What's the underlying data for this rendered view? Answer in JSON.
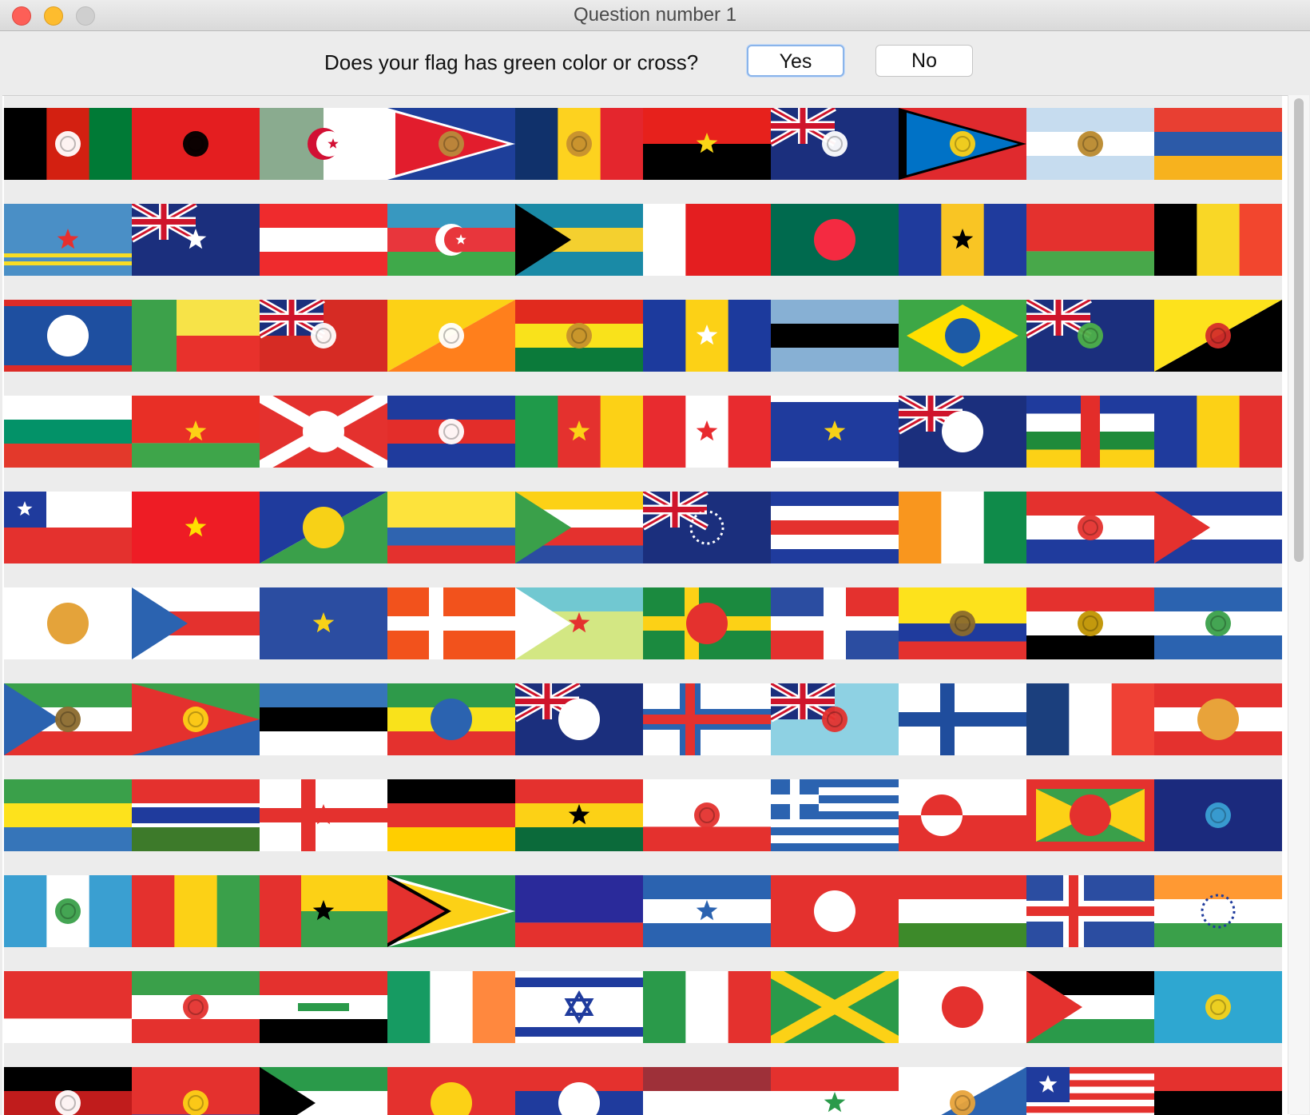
{
  "window": {
    "title": "Question number 1"
  },
  "question": {
    "text": "Does your flag has green color or cross?",
    "yes_label": "Yes",
    "no_label": "No"
  },
  "flags": [
    {
      "name": "afghanistan",
      "layout": "v",
      "colors": [
        "#000000",
        "#d32011",
        "#007a36"
      ],
      "emblem": "circle",
      "emblemColor": "#ffffff"
    },
    {
      "name": "albania",
      "layout": "solid",
      "colors": [
        "#e41e20"
      ],
      "emblem": "circle",
      "emblemColor": "#000000"
    },
    {
      "name": "algeria",
      "layout": "v",
      "colors": [
        "#8aab8f",
        "#ffffff"
      ],
      "emblem": "crescent",
      "emblemColor": "#d21034"
    },
    {
      "name": "american-samoa",
      "layout": "triangle",
      "colors": [
        "#1e3f9a",
        "#ffffff",
        "#e21d2d"
      ],
      "emblem": "circle",
      "emblemColor": "#b88a3b"
    },
    {
      "name": "andorra",
      "layout": "v",
      "colors": [
        "#10316b",
        "#fdd21f",
        "#e4262d"
      ],
      "emblem": "circle",
      "emblemColor": "#c7902f"
    },
    {
      "name": "angola",
      "layout": "h",
      "colors": [
        "#e7211c",
        "#000000"
      ],
      "emblem": "star",
      "emblemColor": "#f9d616"
    },
    {
      "name": "anguilla",
      "layout": "ensign",
      "colors": [
        "#1b2f7d",
        "#ffffff",
        "#cf142b"
      ],
      "emblem": "circle",
      "emblemColor": "#ffffff"
    },
    {
      "name": "antigua-and-barbuda",
      "layout": "triangle",
      "colors": [
        "#e02a2e",
        "#000000",
        "#0072c6",
        "#ffffff"
      ],
      "emblem": "circle",
      "emblemColor": "#fcd116"
    },
    {
      "name": "argentina",
      "layout": "h",
      "colors": [
        "#c6dcef",
        "#ffffff",
        "#c6dcef"
      ],
      "emblem": "circle",
      "emblemColor": "#b9892d"
    },
    {
      "name": "armenia",
      "layout": "h",
      "colors": [
        "#e83f32",
        "#2c5aa8",
        "#f7b21e"
      ]
    },
    {
      "name": "aruba",
      "layout": "stripes",
      "colors": [
        "#4a8fc6",
        "#f8dd26"
      ],
      "emblem": "star",
      "emblemColor": "#e72f2e"
    },
    {
      "name": "australia",
      "layout": "ensign",
      "colors": [
        "#1b2f7d",
        "#ffffff",
        "#cf142b"
      ],
      "emblem": "star",
      "emblemColor": "#ffffff"
    },
    {
      "name": "austria",
      "layout": "h",
      "colors": [
        "#ef2b2d",
        "#ffffff",
        "#ef2b2d"
      ]
    },
    {
      "name": "azerbaijan",
      "layout": "h",
      "colors": [
        "#3898c0",
        "#e8363c",
        "#3fa94a"
      ],
      "emblem": "crescent",
      "emblemColor": "#ffffff"
    },
    {
      "name": "bahamas",
      "layout": "htri",
      "colors": [
        "#1a8aa6",
        "#f4d02f",
        "#1a8aa6",
        "#000000"
      ]
    },
    {
      "name": "bahrain",
      "layout": "v",
      "colors": [
        "#ffffff",
        "#e41e20",
        "#e41e20"
      ]
    },
    {
      "name": "bangladesh",
      "layout": "solid",
      "colors": [
        "#006a4e"
      ],
      "emblem": "disc",
      "emblemColor": "#f42a41"
    },
    {
      "name": "barbados",
      "layout": "v",
      "colors": [
        "#1f3b9d",
        "#f9c524",
        "#1f3b9d"
      ],
      "emblem": "star",
      "emblemColor": "#000000"
    },
    {
      "name": "belarus",
      "layout": "h2",
      "colors": [
        "#e4312e",
        "#48a84a"
      ]
    },
    {
      "name": "belgium",
      "layout": "v",
      "colors": [
        "#000000",
        "#f9d726",
        "#f2462e"
      ]
    },
    {
      "name": "belize",
      "layout": "hbar",
      "colors": [
        "#1e4fa0",
        "#dc2b27"
      ],
      "emblem": "disc",
      "emblemColor": "#ffffff"
    },
    {
      "name": "benin",
      "layout": "benin",
      "colors": [
        "#3ca14a",
        "#f7e348",
        "#e8312c"
      ]
    },
    {
      "name": "bermuda",
      "layout": "ensign",
      "colors": [
        "#d62b24",
        "#ffffff",
        "#1b2f7d"
      ],
      "emblem": "circle",
      "emblemColor": "#ffffff"
    },
    {
      "name": "bhutan",
      "layout": "diag",
      "colors": [
        "#fcd116",
        "#ff7f1c"
      ],
      "emblem": "circle",
      "emblemColor": "#ffffff"
    },
    {
      "name": "bolivia",
      "layout": "h",
      "colors": [
        "#e12a1e",
        "#f9e21b",
        "#0b7a3a"
      ],
      "emblem": "circle",
      "emblemColor": "#c6912c"
    },
    {
      "name": "bosnia",
      "layout": "v",
      "colors": [
        "#1c3a9d",
        "#fcd116",
        "#1c3a9d"
      ],
      "emblem": "star",
      "emblemColor": "#ffffff"
    },
    {
      "name": "botswana",
      "layout": "h",
      "colors": [
        "#87b0d4",
        "#000000",
        "#87b0d4"
      ]
    },
    {
      "name": "brazil",
      "layout": "brazil",
      "colors": [
        "#3da746",
        "#fedf00",
        "#1d5aa6"
      ]
    },
    {
      "name": "british-virgin-islands",
      "layout": "ensign",
      "colors": [
        "#1b2f7d",
        "#ffffff",
        "#cf142b"
      ],
      "emblem": "circle",
      "emblemColor": "#4db04a"
    },
    {
      "name": "brunei",
      "layout": "diag",
      "colors": [
        "#fde21c",
        "#000000"
      ],
      "emblem": "circle",
      "emblemColor": "#d52d2a"
    },
    {
      "name": "bulgaria",
      "layout": "h",
      "colors": [
        "#ffffff",
        "#039268",
        "#e3392b"
      ]
    },
    {
      "name": "burkina-faso",
      "layout": "h2",
      "colors": [
        "#e82f26",
        "#3ea54a"
      ],
      "emblem": "star",
      "emblemColor": "#fcd116"
    },
    {
      "name": "burundi",
      "layout": "saltire",
      "colors": [
        "#e4312e",
        "#3fa349",
        "#ffffff"
      ],
      "emblem": "disc",
      "emblemColor": "#ffffff"
    },
    {
      "name": "cambodia",
      "layout": "h",
      "colors": [
        "#1f3b9d",
        "#e32d2a",
        "#1f3b9d"
      ],
      "emblem": "circle",
      "emblemColor": "#ffffff"
    },
    {
      "name": "cameroon",
      "layout": "v",
      "colors": [
        "#1f9a4a",
        "#e4312e",
        "#fcd116"
      ],
      "emblem": "star",
      "emblemColor": "#fcd116"
    },
    {
      "name": "canada",
      "layout": "v",
      "colors": [
        "#e82b2f",
        "#ffffff",
        "#e82b2f"
      ],
      "emblem": "star",
      "emblemColor": "#e82b2f"
    },
    {
      "name": "cape-verde",
      "layout": "hbar",
      "colors": [
        "#1f3b9d",
        "#ffffff"
      ],
      "emblem": "star",
      "emblemColor": "#f7d117"
    },
    {
      "name": "cayman-islands",
      "layout": "ensign",
      "colors": [
        "#1b2f7d",
        "#ffffff",
        "#cf142b"
      ],
      "emblem": "disc",
      "emblemColor": "#ffffff"
    },
    {
      "name": "central-african-republic",
      "layout": "car",
      "colors": [
        "#1f3b9d",
        "#ffffff",
        "#1f8a3a",
        "#fcd116",
        "#e32d2a"
      ]
    },
    {
      "name": "chad",
      "layout": "v",
      "colors": [
        "#1f3b9d",
        "#fcd116",
        "#e4312e"
      ]
    },
    {
      "name": "chile",
      "layout": "chile",
      "colors": [
        "#1f3b9d",
        "#ffffff",
        "#e4312e"
      ]
    },
    {
      "name": "china",
      "layout": "solid",
      "colors": [
        "#ee1c25"
      ],
      "emblem": "star",
      "emblemColor": "#ffde00"
    },
    {
      "name": "christmas-island",
      "layout": "diagtri",
      "colors": [
        "#1f3b9d",
        "#3aa04a"
      ],
      "emblem": "disc",
      "emblemColor": "#f7d117"
    },
    {
      "name": "colombia",
      "layout": "h",
      "colors": [
        "#fde33c",
        "#fde33c",
        "#2f64b0",
        "#e4312e"
      ]
    },
    {
      "name": "comoros",
      "layout": "htri",
      "colors": [
        "#fcd116",
        "#ffffff",
        "#e4312e",
        "#2b4da1",
        "#3aa04a"
      ]
    },
    {
      "name": "cook-islands",
      "layout": "ensign",
      "colors": [
        "#1b2f7d",
        "#ffffff",
        "#cf142b"
      ],
      "emblem": "ring",
      "emblemColor": "#ffffff"
    },
    {
      "name": "costa-rica",
      "layout": "h",
      "colors": [
        "#1f3b9d",
        "#ffffff",
        "#e4312e",
        "#ffffff",
        "#1f3b9d"
      ]
    },
    {
      "name": "cote-divoire",
      "layout": "v",
      "colors": [
        "#f9961e",
        "#ffffff",
        "#0f8b4a"
      ]
    },
    {
      "name": "croatia",
      "layout": "h",
      "colors": [
        "#e4312e",
        "#ffffff",
        "#1f3b9d"
      ],
      "emblem": "circle",
      "emblemColor": "#e4312e"
    },
    {
      "name": "cuba",
      "layout": "htri",
      "colors": [
        "#1f3b9d",
        "#ffffff",
        "#1f3b9d",
        "#e4312e"
      ]
    },
    {
      "name": "cyprus",
      "layout": "solid",
      "colors": [
        "#ffffff"
      ],
      "emblem": "disc",
      "emblemColor": "#e4a33a"
    },
    {
      "name": "czech-republic",
      "layout": "htri",
      "colors": [
        "#ffffff",
        "#e4312e",
        "#ffffff",
        "#2b63b0"
      ]
    },
    {
      "name": "dr-congo-old",
      "layout": "solid",
      "colors": [
        "#2b4da1"
      ],
      "emblem": "star",
      "emblemColor": "#f7d117"
    },
    {
      "name": "denmark",
      "layout": "cross",
      "colors": [
        "#f2521c",
        "#ffffff"
      ]
    },
    {
      "name": "djibouti",
      "layout": "htri",
      "colors": [
        "#71c8d1",
        "#d3e783",
        "#d3e783",
        "#ffffff"
      ],
      "emblem": "star",
      "emblemColor": "#e4312e"
    },
    {
      "name": "dominica",
      "layout": "cross",
      "colors": [
        "#1b8a3f",
        "#fcd116"
      ],
      "emblem": "disc",
      "emblemColor": "#e4312e"
    },
    {
      "name": "dominican-republic",
      "layout": "quarters",
      "colors": [
        "#2b4da1",
        "#e4312e",
        "#ffffff"
      ]
    },
    {
      "name": "ecuador",
      "layout": "h",
      "colors": [
        "#fde21c",
        "#fde21c",
        "#1f3b9d",
        "#e4312e"
      ],
      "emblem": "circle",
      "emblemColor": "#8b6a2d"
    },
    {
      "name": "egypt",
      "layout": "h",
      "colors": [
        "#e4312e",
        "#ffffff",
        "#000000"
      ],
      "emblem": "circle",
      "emblemColor": "#c09300"
    },
    {
      "name": "el-salvador",
      "layout": "h",
      "colors": [
        "#2b63b0",
        "#ffffff",
        "#2b63b0"
      ],
      "emblem": "circle",
      "emblemColor": "#3aa04a"
    },
    {
      "name": "equatorial-guinea",
      "layout": "htri",
      "colors": [
        "#3aa04a",
        "#ffffff",
        "#e4312e",
        "#2b63b0"
      ],
      "emblem": "circle",
      "emblemColor": "#8b6a2d"
    },
    {
      "name": "eritrea",
      "layout": "eritrea",
      "colors": [
        "#3aa04a",
        "#2b63b0",
        "#e4312e"
      ],
      "emblem": "circle",
      "emblemColor": "#fcd116"
    },
    {
      "name": "estonia",
      "layout": "h",
      "colors": [
        "#3675b9",
        "#000000",
        "#ffffff"
      ]
    },
    {
      "name": "ethiopia",
      "layout": "h",
      "colors": [
        "#2e9a4a",
        "#f9e21b",
        "#e4312e"
      ],
      "emblem": "disc",
      "emblemColor": "#2b63b0"
    },
    {
      "name": "falkland-islands",
      "layout": "ensign",
      "colors": [
        "#1b2f7d",
        "#ffffff",
        "#cf142b"
      ],
      "emblem": "disc",
      "emblemColor": "#ffffff"
    },
    {
      "name": "faroe-islands",
      "layout": "cross2",
      "colors": [
        "#ffffff",
        "#2b63b0",
        "#e4312e"
      ]
    },
    {
      "name": "fiji",
      "layout": "ensign",
      "colors": [
        "#8ed1e3",
        "#ffffff",
        "#cf142b"
      ],
      "emblem": "circle",
      "emblemColor": "#e4312e"
    },
    {
      "name": "finland",
      "layout": "cross",
      "colors": [
        "#ffffff",
        "#1f4d9d"
      ]
    },
    {
      "name": "france",
      "layout": "v",
      "colors": [
        "#1b3f7d",
        "#ffffff",
        "#ef4135"
      ]
    },
    {
      "name": "french-polynesia",
      "layout": "h",
      "colors": [
        "#e4312e",
        "#ffffff",
        "#e4312e"
      ],
      "emblem": "disc",
      "emblemColor": "#e8a33a"
    },
    {
      "name": "gabon",
      "layout": "h",
      "colors": [
        "#3aa04a",
        "#fde21c",
        "#3675b9"
      ]
    },
    {
      "name": "gambia",
      "layout": "gambia",
      "colors": [
        "#e4312e",
        "#1f3b9d",
        "#3d7a2a"
      ]
    },
    {
      "name": "georgia",
      "layout": "cross",
      "colors": [
        "#ffffff",
        "#e4312e"
      ],
      "emblem": "star",
      "emblemColor": "#e4312e"
    },
    {
      "name": "germany",
      "layout": "h",
      "colors": [
        "#000000",
        "#e4312e",
        "#ffce00"
      ]
    },
    {
      "name": "ghana",
      "layout": "h",
      "colors": [
        "#e4312e",
        "#fcd116",
        "#0b6a3a"
      ],
      "emblem": "star",
      "emblemColor": "#000000"
    },
    {
      "name": "gibraltar",
      "layout": "h2",
      "colors": [
        "#ffffff",
        "#e4312e"
      ],
      "emblem": "circle",
      "emblemColor": "#e4312e"
    },
    {
      "name": "greece",
      "layout": "greece",
      "colors": [
        "#2b63b0",
        "#ffffff"
      ]
    },
    {
      "name": "greenland",
      "layout": "greenland",
      "colors": [
        "#ffffff",
        "#e4312e"
      ]
    },
    {
      "name": "grenada",
      "layout": "grenada",
      "colors": [
        "#e4312e",
        "#fcd116",
        "#3aa04a"
      ],
      "emblem": "disc",
      "emblemColor": "#e4312e"
    },
    {
      "name": "guam",
      "layout": "solid",
      "colors": [
        "#1b2a7d"
      ],
      "emblem": "circle",
      "emblemColor": "#3aa0d4"
    },
    {
      "name": "guatemala",
      "layout": "v",
      "colors": [
        "#3a9fd1",
        "#ffffff",
        "#3a9fd1"
      ],
      "emblem": "circle",
      "emblemColor": "#3aa04a"
    },
    {
      "name": "guinea",
      "layout": "v",
      "colors": [
        "#e4312e",
        "#fcd116",
        "#3aa04a"
      ]
    },
    {
      "name": "guinea-bissau",
      "layout": "gb",
      "colors": [
        "#e4312e",
        "#fcd116",
        "#3aa04a"
      ],
      "emblem": "star",
      "emblemColor": "#000000"
    },
    {
      "name": "guyana",
      "layout": "guyana",
      "colors": [
        "#2a9a4a",
        "#ffffff",
        "#fcd116",
        "#000000",
        "#e4312e"
      ]
    },
    {
      "name": "haiti",
      "layout": "h2",
      "colors": [
        "#2a2a9a",
        "#e4312e"
      ]
    },
    {
      "name": "honduras",
      "layout": "h",
      "colors": [
        "#2b63b0",
        "#ffffff",
        "#2b63b0"
      ],
      "emblem": "star",
      "emblemColor": "#2b63b0"
    },
    {
      "name": "hong-kong",
      "layout": "solid",
      "colors": [
        "#e4312e"
      ],
      "emblem": "disc",
      "emblemColor": "#ffffff"
    },
    {
      "name": "hungary",
      "layout": "h",
      "colors": [
        "#e4312e",
        "#ffffff",
        "#3d8a2a"
      ]
    },
    {
      "name": "iceland",
      "layout": "cross2",
      "colors": [
        "#2b4da1",
        "#ffffff",
        "#e4312e"
      ]
    },
    {
      "name": "india",
      "layout": "h",
      "colors": [
        "#ff9933",
        "#ffffff",
        "#3aa04a"
      ],
      "emblem": "ring",
      "emblemColor": "#1f3b9d"
    },
    {
      "name": "indonesia",
      "layout": "h2",
      "colors": [
        "#e4312e",
        "#ffffff"
      ]
    },
    {
      "name": "iran",
      "layout": "h",
      "colors": [
        "#3aa04a",
        "#ffffff",
        "#e4312e"
      ],
      "emblem": "circle",
      "emblemColor": "#e4312e"
    },
    {
      "name": "iraq",
      "layout": "h",
      "colors": [
        "#e4312e",
        "#ffffff",
        "#000000"
      ],
      "emblem": "text",
      "emblemColor": "#2a9a4a"
    },
    {
      "name": "ireland",
      "layout": "v",
      "colors": [
        "#169b62",
        "#ffffff",
        "#ff883e"
      ]
    },
    {
      "name": "israel",
      "layout": "israel",
      "colors": [
        "#ffffff",
        "#1f3b9d"
      ]
    },
    {
      "name": "italy",
      "layout": "v",
      "colors": [
        "#2a9a4a",
        "#ffffff",
        "#e4312e"
      ]
    },
    {
      "name": "jamaica",
      "layout": "saltire",
      "colors": [
        "#2a9a4a",
        "#000000",
        "#fcd116"
      ]
    },
    {
      "name": "japan",
      "layout": "solid",
      "colors": [
        "#ffffff"
      ],
      "emblem": "disc",
      "emblemColor": "#e4312e"
    },
    {
      "name": "jordan",
      "layout": "htri",
      "colors": [
        "#000000",
        "#ffffff",
        "#2a9a4a",
        "#e4312e"
      ],
      "emblem": "star",
      "emblemColor": "#ffffff"
    },
    {
      "name": "kazakhstan",
      "layout": "solid",
      "colors": [
        "#2ea7d1"
      ],
      "emblem": "circle",
      "emblemColor": "#f7d117"
    },
    {
      "name": "kenya",
      "layout": "h",
      "colors": [
        "#000000",
        "#c01c1c",
        "#2a7a3a"
      ],
      "emblem": "circle",
      "emblemColor": "#ffffff"
    },
    {
      "name": "kiribati",
      "layout": "h2",
      "colors": [
        "#e4312e",
        "#1f3b9d"
      ],
      "emblem": "circle",
      "emblemColor": "#fcd116"
    },
    {
      "name": "kuwait",
      "layout": "htri",
      "colors": [
        "#2a9a4a",
        "#ffffff",
        "#e4312e",
        "#000000"
      ]
    },
    {
      "name": "kyrgyzstan",
      "layout": "solid",
      "colors": [
        "#e4312e"
      ],
      "emblem": "disc",
      "emblemColor": "#fcd116"
    },
    {
      "name": "laos",
      "layout": "h",
      "colors": [
        "#e4312e",
        "#1f3b9d",
        "#e4312e"
      ],
      "emblem": "disc",
      "emblemColor": "#ffffff"
    },
    {
      "name": "latvia",
      "layout": "h",
      "colors": [
        "#9e3039",
        "#ffffff",
        "#9e3039"
      ]
    },
    {
      "name": "lebanon",
      "layout": "h",
      "colors": [
        "#e4312e",
        "#ffffff",
        "#e4312e"
      ],
      "emblem": "star",
      "emblemColor": "#2a9a4a"
    },
    {
      "name": "lesotho",
      "layout": "diagtri",
      "colors": [
        "#ffffff",
        "#2b63b0"
      ],
      "emblem": "circle",
      "emblemColor": "#e8a33a"
    },
    {
      "name": "liberia",
      "layout": "liberia",
      "colors": [
        "#e4312e",
        "#ffffff",
        "#1f3b9d"
      ]
    },
    {
      "name": "libya",
      "layout": "h",
      "colors": [
        "#e4312e",
        "#000000",
        "#2a9a4a"
      ]
    }
  ]
}
